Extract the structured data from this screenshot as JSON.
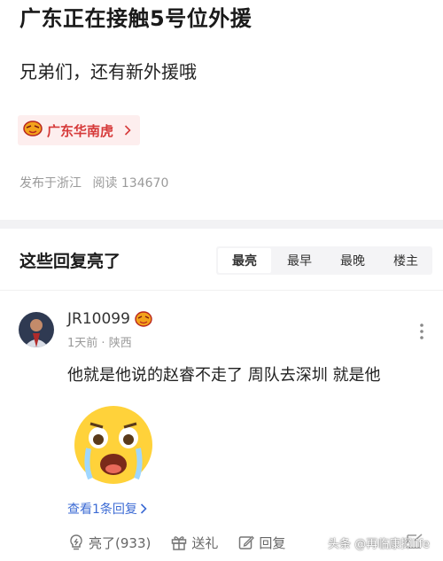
{
  "post": {
    "title": "广东正在接触5号位外援",
    "body": "兄弟们，还有新外援哦",
    "topic_tag": "广东华南虎",
    "meta_location": "发布于浙江",
    "meta_reads": "阅读 134670"
  },
  "replies_section": {
    "title": "这些回复亮了",
    "sort_tabs": [
      "最亮",
      "最早",
      "最晚",
      "楼主"
    ],
    "active_tab": "最亮"
  },
  "comment": {
    "username": "JR10099",
    "time": "1天前",
    "separator": "·",
    "location": "陕西",
    "text": "他就是他说的赵睿不走了 周队去深圳 就是他",
    "view_replies": "查看1条回复",
    "actions": {
      "like": "亮了(933)",
      "gift": "送礼",
      "reply": "回复"
    }
  },
  "watermark": "头条 @再临康探life",
  "colors": {
    "topic_bg": "#fdeeee",
    "topic_text": "#d63a3a",
    "link_blue": "#3c6bd4",
    "divider": "#f2f2f4"
  }
}
